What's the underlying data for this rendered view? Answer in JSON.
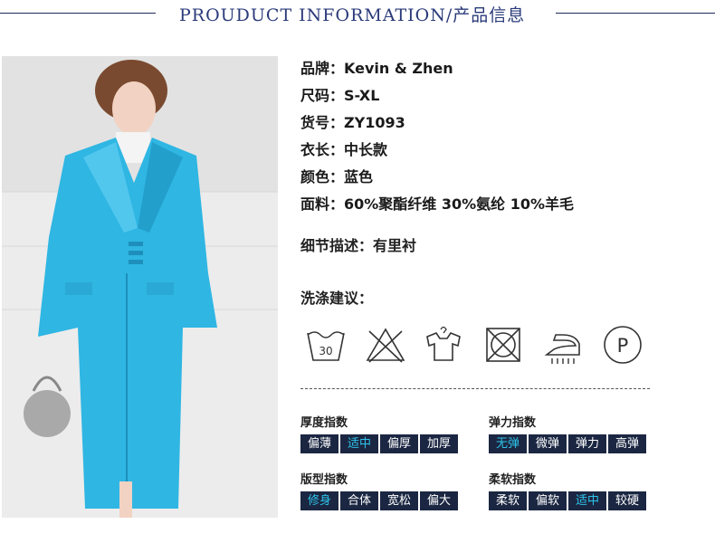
{
  "header": {
    "title": "PROUDUCT INFORMATION/产品信息"
  },
  "info": {
    "brand": "品牌：Kevin & Zhen",
    "size": "尺码：S-XL",
    "item_no": "货号：ZY1093",
    "length": "衣长：中长款",
    "color": "颜色：蓝色",
    "fabric": "面料：60%聚酯纤维 30%氨纶 10%羊毛"
  },
  "detail": "细节描述：有里衬",
  "wash_title": "洗涤建议：",
  "wash_icons": {
    "wash30_text": "30",
    "dryclean_text": "P"
  },
  "indices": {
    "thickness": {
      "label": "厚度指数",
      "options": [
        "偏薄",
        "适中",
        "偏厚",
        "加厚"
      ],
      "active": "适中"
    },
    "elasticity": {
      "label": "弹力指数",
      "options": [
        "无弹",
        "微弹",
        "弹力",
        "高弹"
      ],
      "active": "无弹"
    },
    "fit": {
      "label": "版型指数",
      "options": [
        "修身",
        "合体",
        "宽松",
        "偏大"
      ],
      "active": "修身"
    },
    "softness": {
      "label": "柔软指数",
      "options": [
        "柔软",
        "偏软",
        "适中",
        "较硬"
      ],
      "active": "适中"
    }
  },
  "colors": {
    "accent_text": "#2ec3ea",
    "cell_bg": "#1b2742",
    "coat": "#2fb6e3"
  }
}
